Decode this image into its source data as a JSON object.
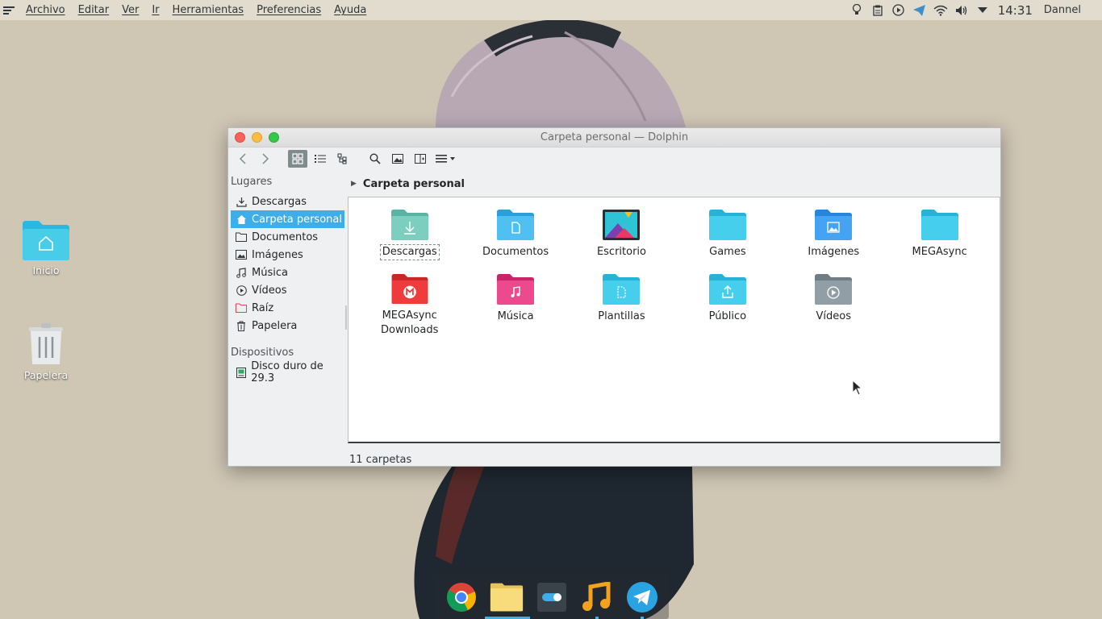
{
  "topbar": {
    "menus": [
      "Archivo",
      "Editar",
      "Ver",
      "Ir",
      "Herramientas",
      "Preferencias",
      "Ayuda"
    ],
    "clock": "14:31",
    "user": "Dannel"
  },
  "desktop": {
    "icons": [
      {
        "label": "Inicio",
        "icon": "home-folder-icon"
      },
      {
        "label": "Papelera",
        "icon": "trash-icon"
      }
    ]
  },
  "window": {
    "title": "Carpeta personal — Dolphin",
    "places": {
      "heading": "Lugares",
      "items": [
        {
          "label": "Descargas",
          "icon": "download-icon"
        },
        {
          "label": "Carpeta personal",
          "icon": "home-icon",
          "selected": true
        },
        {
          "label": "Documentos",
          "icon": "folder-icon"
        },
        {
          "label": "Imágenes",
          "icon": "image-icon"
        },
        {
          "label": "Música",
          "icon": "music-icon"
        },
        {
          "label": "Vídeos",
          "icon": "video-icon"
        },
        {
          "label": "Raíz",
          "icon": "root-folder-icon"
        },
        {
          "label": "Papelera",
          "icon": "trash-icon"
        }
      ],
      "devices_heading": "Dispositivos",
      "devices": [
        {
          "label": "Disco duro de 29.3",
          "icon": "drive-icon"
        }
      ]
    },
    "breadcrumb": "Carpeta personal",
    "folders": [
      {
        "label": "Descargas",
        "color": "#70c3b2",
        "emblem": "download"
      },
      {
        "label": "Documentos",
        "color": "#48b9ee",
        "emblem": "document"
      },
      {
        "label": "Escritorio",
        "color": "#2b2f33",
        "emblem": "desktop"
      },
      {
        "label": "Games",
        "color": "#3fc7e8",
        "emblem": "none"
      },
      {
        "label": "Imágenes",
        "color": "#3b9ff0",
        "emblem": "image"
      },
      {
        "label": "MEGAsync",
        "color": "#3fc7e8",
        "emblem": "none"
      },
      {
        "label": "MEGAsync Downloads",
        "color": "#e53935",
        "emblem": "mega"
      },
      {
        "label": "Música",
        "color": "#e8357b",
        "emblem": "music"
      },
      {
        "label": "Plantillas",
        "color": "#3fc7e8",
        "emblem": "template"
      },
      {
        "label": "Público",
        "color": "#3fc7e8",
        "emblem": "share"
      },
      {
        "label": "Vídeos",
        "color": "#8d9aa2",
        "emblem": "video"
      }
    ],
    "status": "11 carpetas"
  },
  "dock": {
    "apps": [
      "chrome-icon",
      "files-icon",
      "settings-toggle-icon",
      "music-player-icon",
      "telegram-icon"
    ]
  },
  "colors": {
    "accent": "#3daee9",
    "topbar": "#e2dccf",
    "desktop": "#cfc6b4"
  }
}
